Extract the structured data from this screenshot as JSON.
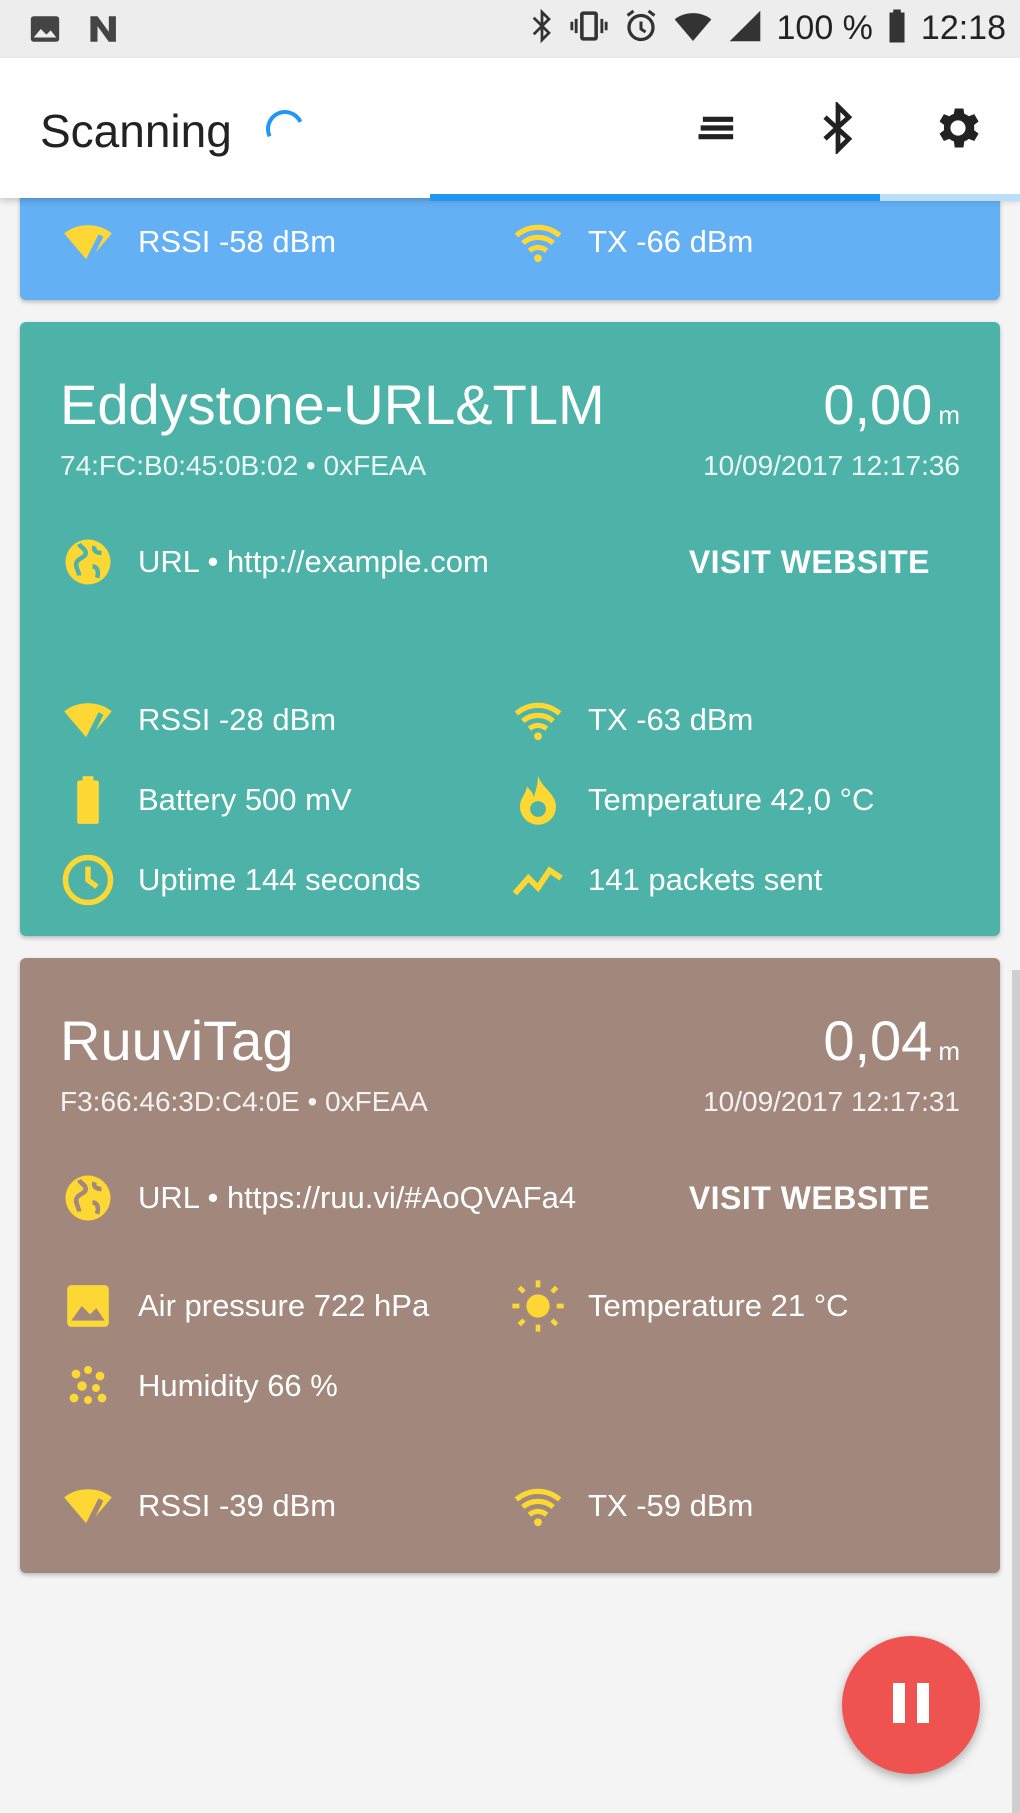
{
  "status": {
    "battery": "100 %",
    "time": "12:18"
  },
  "appbar": {
    "title": "Scanning"
  },
  "colors": {
    "accent": "#2196f3",
    "icon_yellow": "#fdd835",
    "teal": "#4db3a9",
    "brown": "#a1877c",
    "blue": "#64b0f4",
    "fab": "#ef5350"
  },
  "card_top": {
    "rssi": "RSSI -58 dBm",
    "tx": "TX -66 dBm"
  },
  "card_eddystone": {
    "name": "Eddystone-URL&TLM",
    "distance": "0,00",
    "unit": "m",
    "address": "74:FC:B0:45:0B:02   •   0xFEAA",
    "timestamp": "10/09/2017 12:17:36",
    "url": "URL • http://example.com",
    "visit": "VISIT WEBSITE",
    "rssi": "RSSI -28 dBm",
    "tx": "TX -63 dBm",
    "battery": "Battery 500 mV",
    "temperature": "Temperature 42,0 °C",
    "uptime": "Uptime 144 seconds",
    "packets": "141 packets sent"
  },
  "card_ruuvi": {
    "name": "RuuviTag",
    "distance": "0,04",
    "unit": "m",
    "address": "F3:66:46:3D:C4:0E   •   0xFEAA",
    "timestamp": "10/09/2017 12:17:31",
    "url": "URL • https://ruu.vi/#AoQVAFa4",
    "visit": "VISIT WEBSITE",
    "pressure": "Air pressure 722 hPa",
    "temperature": "Temperature 21 °C",
    "humidity": "Humidity 66 %",
    "rssi": "RSSI -39 dBm",
    "tx": "TX -59 dBm"
  }
}
